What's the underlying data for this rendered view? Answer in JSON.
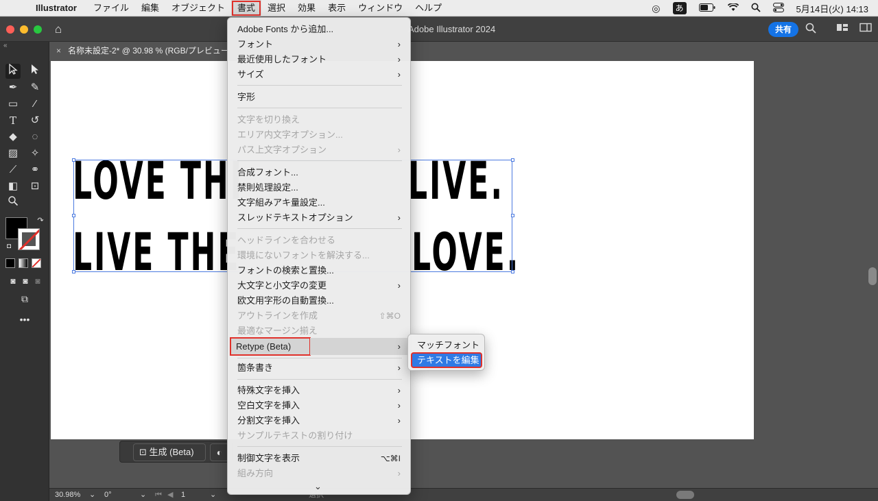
{
  "menubar": {
    "app_name": "Illustrator",
    "items": [
      "ファイル",
      "編集",
      "オブジェクト",
      "書式",
      "選択",
      "効果",
      "表示",
      "ウィンドウ",
      "ヘルプ"
    ],
    "active_item": "書式",
    "ime": "あ",
    "clock": "5月14日(火) 14:13"
  },
  "titlebar": {
    "title": "Adobe Illustrator 2024",
    "share_label": "共有"
  },
  "document": {
    "tab_title": "名称未設定-2* @ 30.98 % (RGB/プレビュー)",
    "line1_left": "LOVE THI",
    "line1_right": "LIVE.",
    "line2_left": "LIVE THE",
    "line2_right": "LOVE."
  },
  "menu": {
    "items": [
      {
        "label": "Adobe Fonts から追加...",
        "submenu": false,
        "disabled": false
      },
      {
        "label": "フォント",
        "submenu": true,
        "disabled": false
      },
      {
        "label": "最近使用したフォント",
        "submenu": true,
        "disabled": false
      },
      {
        "label": "サイズ",
        "submenu": true,
        "disabled": false
      },
      {
        "label": "字形",
        "submenu": false,
        "disabled": false
      },
      {
        "label": "文字を切り換え",
        "submenu": false,
        "disabled": true
      },
      {
        "label": "エリア内文字オプション...",
        "submenu": false,
        "disabled": true
      },
      {
        "label": "パス上文字オプション",
        "submenu": true,
        "disabled": true
      },
      {
        "label": "合成フォント...",
        "submenu": false,
        "disabled": false
      },
      {
        "label": "禁則処理設定...",
        "submenu": false,
        "disabled": false
      },
      {
        "label": "文字組みアキ量設定...",
        "submenu": false,
        "disabled": false
      },
      {
        "label": "スレッドテキストオプション",
        "submenu": true,
        "disabled": false
      },
      {
        "label": "ヘッドラインを合わせる",
        "submenu": false,
        "disabled": true
      },
      {
        "label": "環境にないフォントを解決する...",
        "submenu": false,
        "disabled": true
      },
      {
        "label": "フォントの検索と置換...",
        "submenu": false,
        "disabled": false
      },
      {
        "label": "大文字と小文字の変更",
        "submenu": true,
        "disabled": false
      },
      {
        "label": "欧文用字形の自動置換...",
        "submenu": false,
        "disabled": false
      },
      {
        "label": "アウトラインを作成",
        "submenu": false,
        "disabled": true,
        "shortcut": "⇧⌘O"
      },
      {
        "label": "最適なマージン揃え",
        "submenu": false,
        "disabled": true
      },
      {
        "label": "Retype (Beta)",
        "submenu": true,
        "disabled": false
      },
      {
        "label": "箇条書き",
        "submenu": true,
        "disabled": false
      },
      {
        "label": "特殊文字を挿入",
        "submenu": true,
        "disabled": false
      },
      {
        "label": "空白文字を挿入",
        "submenu": true,
        "disabled": false
      },
      {
        "label": "分割文字を挿入",
        "submenu": true,
        "disabled": false
      },
      {
        "label": "サンプルテキストの割り付け",
        "submenu": false,
        "disabled": true
      },
      {
        "label": "制御文字を表示",
        "submenu": false,
        "disabled": false,
        "shortcut": "⌥⌘I"
      },
      {
        "label": "組み方向",
        "submenu": true,
        "disabled": true
      }
    ],
    "more_glyph": "⌄"
  },
  "submenu": {
    "items": [
      "マッチフォント",
      "テキストを編集"
    ],
    "selected": "テキストを編集"
  },
  "taskbar": {
    "generate_label": "生成 (Beta)"
  },
  "statusbar": {
    "zoom": "30.98%",
    "rotation": "0°",
    "artboard": "1",
    "mode": "選択"
  }
}
